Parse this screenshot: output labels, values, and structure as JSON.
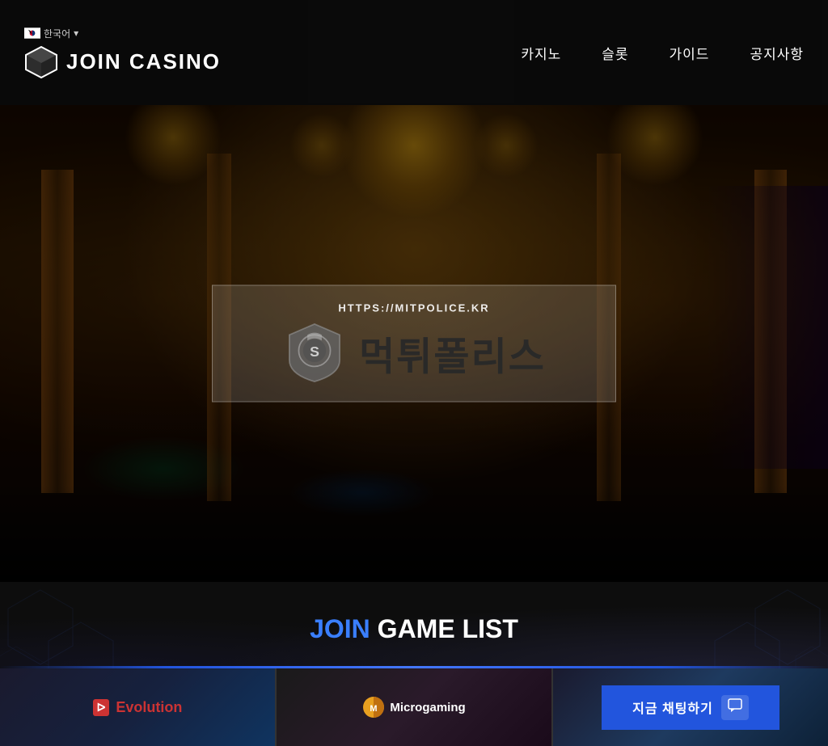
{
  "header": {
    "lang_selector": "한국어",
    "lang_arrow": "▾",
    "logo_text": "JOIN CASINO",
    "nav": [
      {
        "id": "casino",
        "label": "카지노"
      },
      {
        "id": "slots",
        "label": "슬롯"
      },
      {
        "id": "guide",
        "label": "가이드"
      },
      {
        "id": "notice",
        "label": "공지사항"
      }
    ]
  },
  "hero": {
    "watermark": {
      "url": "HTTPS://MITPOLICE.KR",
      "korean_text": "먹튀폴리스"
    }
  },
  "bottom": {
    "title_highlight": "JOIN",
    "title_rest": " GAME LIST",
    "providers": [
      {
        "id": "evolution",
        "label": "Evolution"
      },
      {
        "id": "microgaming",
        "label": "Microgaming"
      }
    ],
    "chat_button_label": "지금 채팅하기",
    "chat_icon": "💬"
  }
}
